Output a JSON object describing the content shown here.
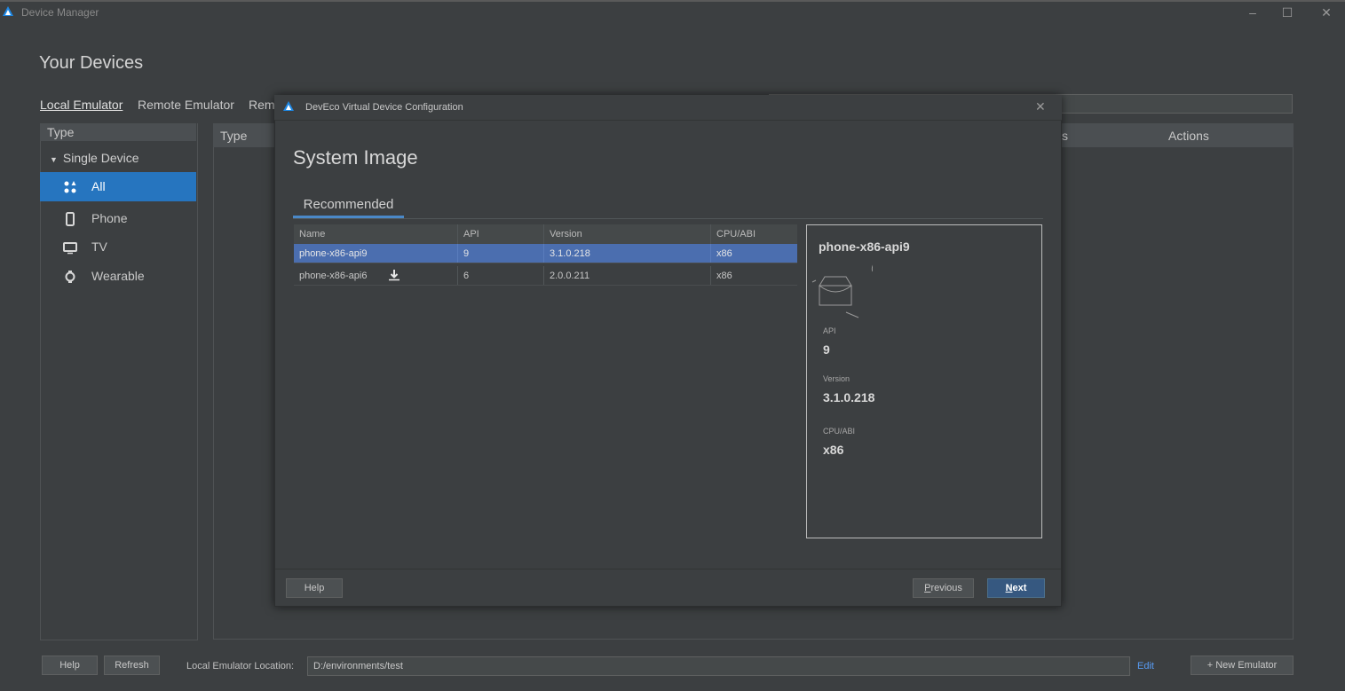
{
  "window": {
    "title": "Device Manager",
    "controls": [
      "minimize-icon",
      "maximize-icon",
      "close-icon"
    ]
  },
  "header": {
    "title": "Your Devices"
  },
  "tabs": [
    {
      "label": "Local Emulator",
      "active": true
    },
    {
      "label": "Remote Emulator",
      "active": false
    },
    {
      "label": "Rem",
      "active": false
    }
  ],
  "sidebar": {
    "header": "Type",
    "group": "Single Device",
    "items": [
      {
        "label": "All",
        "icon": "grid-icon",
        "active": true
      },
      {
        "label": "Phone",
        "icon": "phone-icon",
        "active": false
      },
      {
        "label": "TV",
        "icon": "tv-icon",
        "active": false
      },
      {
        "label": "Wearable",
        "icon": "watch-icon",
        "active": false
      }
    ]
  },
  "main": {
    "columns": {
      "type": "Type",
      "s": "s",
      "actions": "Actions"
    }
  },
  "footer": {
    "help": "Help",
    "refresh": "Refresh",
    "location_label": "Local Emulator Location:",
    "location_value": "D:/environments/test",
    "edit": "Edit",
    "new_emulator": "+ New Emulator"
  },
  "dialog": {
    "title": "DevEco Virtual Device Configuration",
    "heading": "System Image",
    "tab": "Recommended",
    "table": {
      "headers": [
        "Name",
        "API",
        "Version",
        "CPU/ABI"
      ],
      "rows": [
        {
          "name": "phone-x86-api9",
          "api": "9",
          "version": "3.1.0.218",
          "cpu": "x86",
          "selected": true,
          "download": false
        },
        {
          "name": "phone-x86-api6",
          "api": "6",
          "version": "2.0.0.211",
          "cpu": "x86",
          "selected": false,
          "download": true
        }
      ]
    },
    "detail": {
      "name": "phone-x86-api9",
      "api_label": "API",
      "api_value": "9",
      "version_label": "Version",
      "version_value": "3.1.0.218",
      "cpu_label": "CPU/ABI",
      "cpu_value": "x86"
    },
    "buttons": {
      "help": "Help",
      "previous_p": "P",
      "previous_rest": "revious",
      "next_n": "N",
      "next_rest": "ext"
    }
  },
  "colors": {
    "accent": "#2675bf",
    "selected_row": "#4b6eaf",
    "primary_button": "#365880",
    "link": "#589df6"
  }
}
